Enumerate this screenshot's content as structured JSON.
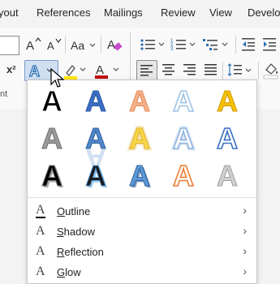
{
  "tabs": [
    "yout",
    "References",
    "Mailings",
    "Review",
    "View",
    "Develo"
  ],
  "ribbon": {
    "left_label": "nt",
    "superscript": "x²",
    "font_color_hex": "#c00000",
    "highlight_hex": "#ffe600",
    "text_effects_letter": "A",
    "grow_font": "A^",
    "shrink_font": "Aˇ",
    "change_case": "Aa",
    "icons": [
      "grow-font-icon",
      "shrink-font-icon",
      "change-case-icon",
      "clear-formatting-icon",
      "bullets-icon",
      "numbering-icon",
      "multilevel-list-icon",
      "decrease-indent-icon",
      "increase-indent-icon",
      "text-effects-icon",
      "highlight-icon",
      "font-color-icon",
      "align-left-icon",
      "center-icon",
      "align-right-icon",
      "justify-icon",
      "line-spacing-icon",
      "shading-icon"
    ]
  },
  "text_effects_gallery": {
    "glyph": "A",
    "styles": [
      {
        "fill": "#000000",
        "stroke": "#ffffff",
        "effect": "plain-black"
      },
      {
        "fill": "#3b6fc4",
        "stroke": "#2a56a0",
        "effect": "blue-gradient"
      },
      {
        "fill": "#f4b08a",
        "stroke": "#e8895a",
        "effect": "orange-outline"
      },
      {
        "fill": "#ffffff",
        "stroke": "#9dc3e6",
        "effect": "light-blue-outline"
      },
      {
        "fill": "#f5c000",
        "stroke": "#d09a00",
        "effect": "gold-bevel"
      },
      {
        "fill": "#9a9a9a",
        "stroke": "#6e6e6e",
        "effect": "gray-gradient"
      },
      {
        "fill": "#4f87c8",
        "stroke": "#2e5f9c",
        "effect": "blue-reflection"
      },
      {
        "fill": "#f8d84a",
        "stroke": "#e0b020",
        "effect": "yellow-glow"
      },
      {
        "fill": "#ffffff",
        "stroke": "#8eb4df",
        "effect": "blue-glow-outline"
      },
      {
        "fill": "#ffffff",
        "stroke": "#3b6fc4",
        "effect": "blue-double-outline"
      },
      {
        "fill": "#000000",
        "stroke": "#777777",
        "effect": "black-shadow"
      },
      {
        "fill": "#1a1a1a",
        "stroke": "#5aa0e0",
        "effect": "black-blue-shadow"
      },
      {
        "fill": "#5b9bd5",
        "stroke": "#2e5f9c",
        "effect": "blue-3d"
      },
      {
        "fill": "#ffffff",
        "stroke": "#ed7d31",
        "effect": "orange-outline-white"
      },
      {
        "fill": "#d0d0d0",
        "stroke": "#a0a0a0",
        "effect": "silver"
      }
    ]
  },
  "menu": [
    {
      "label": "Outline",
      "key": "O",
      "rest": "utline",
      "icon": "outline-icon"
    },
    {
      "label": "Shadow",
      "key": "S",
      "rest": "hadow",
      "icon": "shadow-icon"
    },
    {
      "label": "Reflection",
      "key": "R",
      "rest": "eflection",
      "icon": "reflection-icon"
    },
    {
      "label": "Glow",
      "key": "G",
      "rest": "low",
      "icon": "glow-icon"
    }
  ]
}
